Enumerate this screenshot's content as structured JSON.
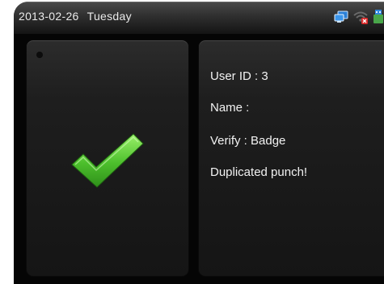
{
  "status_bar": {
    "date": "2013-02-26",
    "weekday": "Tuesday",
    "icons": [
      "network-icon",
      "wifi-disconnected-icon",
      "usb-icon"
    ]
  },
  "result_panel": {
    "icon": "check-mark-icon",
    "accent_color": "#5cc832"
  },
  "info_panel": {
    "user_id": "User ID : 3",
    "name": "Name :",
    "verify": "Verify : Badge",
    "message": "Duplicated punch!"
  }
}
